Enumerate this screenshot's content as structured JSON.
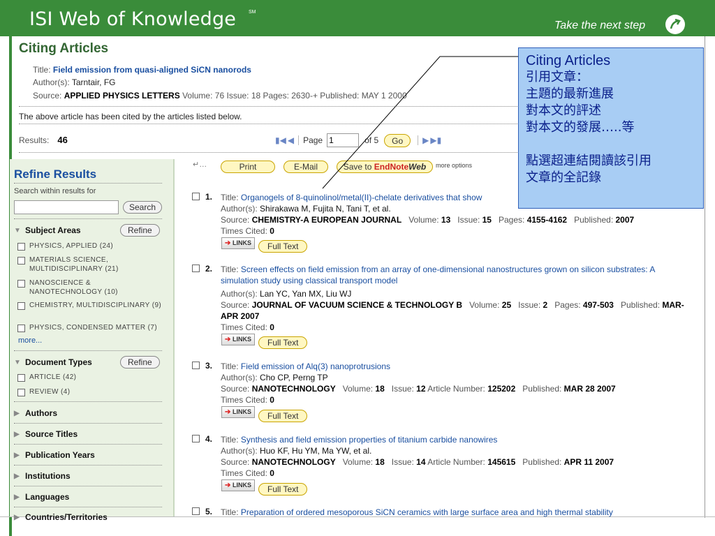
{
  "header": {
    "title": "ISI Web of Knowledge",
    "trademark": "SM",
    "tagline": "Take the next step"
  },
  "page": {
    "title": "Citing Articles",
    "article": {
      "title_label": "Title:",
      "title": "Field emission from quasi-aligned SiCN nanorods",
      "authors_label": "Author(s):",
      "authors": "Tarntair, FG",
      "source_label": "Source:",
      "source": "APPLIED PHYSICS LETTERS",
      "volume_label": "Volume:",
      "volume": "76",
      "issue_label": "Issue:",
      "issue": "18",
      "pages_label": "Pages:",
      "pages": "2630-+",
      "published_label": "Published:",
      "published": "MAY 1 2000"
    },
    "cited_note": "The above article has been cited by the articles listed below.",
    "results_label": "Results:",
    "results_count": "46",
    "pager": {
      "page_label": "Page",
      "page_value": "1",
      "of_label": "of 5",
      "go_label": "Go"
    }
  },
  "toolbar": {
    "print": "Print",
    "email": "E-Mail",
    "save_prefix": "Save to ",
    "save_endnote": "EndNote",
    "save_web": "Web",
    "more_options": "more options"
  },
  "sidebar": {
    "title": "Refine Results",
    "search_hint": "Search within results for",
    "search_button": "Search",
    "subject_areas": {
      "label": "Subject Areas",
      "refine": "Refine",
      "items": [
        "PHYSICS, APPLIED (24)",
        "MATERIALS SCIENCE, MULTIDISCIPLINARY (21)",
        "NANOSCIENCE & NANOTECHNOLOGY (10)",
        "CHEMISTRY, MULTIDISCIPLINARY (9)",
        "PHYSICS, CONDENSED MATTER (7)"
      ],
      "more": "more..."
    },
    "document_types": {
      "label": "Document Types",
      "refine": "Refine",
      "items": [
        "ARTICLE (42)",
        "REVIEW (4)"
      ]
    },
    "collapsed": [
      "Authors",
      "Source Titles",
      "Publication Years",
      "Institutions",
      "Languages",
      "Countries/Territories"
    ]
  },
  "records": [
    {
      "num": "1.",
      "title": "Organogels of 8-quinolinol/metal(II)-chelate derivatives that show",
      "authors": "Shirakawa M, Fujita N, Tani T, et al.",
      "source": "CHEMISTRY-A EUROPEAN JOURNAL",
      "volume": "13",
      "issue": "15",
      "pages": "4155-4162",
      "published": "2007",
      "times_cited": "0"
    },
    {
      "num": "2.",
      "title": "Screen effects on field emission from an array of one-dimensional nanostructures grown on silicon substrates: A simulation study using classical transport model",
      "authors": "Lan YC, Yan MX, Liu WJ",
      "source": "JOURNAL OF VACUUM SCIENCE & TECHNOLOGY B",
      "volume": "25",
      "issue": "2",
      "pages": "497-503",
      "published": "MAR-APR 2007",
      "times_cited": "0"
    },
    {
      "num": "3.",
      "title": "Field emission of Alq(3) nanoprotrusions",
      "authors": "Cho CP, Perng TP",
      "source": "NANOTECHNOLOGY",
      "volume": "18",
      "issue": "12",
      "article_number": "125202",
      "published": "MAR 28 2007",
      "times_cited": "0"
    },
    {
      "num": "4.",
      "title": "Synthesis and field emission properties of titanium carbide nanowires",
      "authors": "Huo KF, Hu YM, Ma YW, et al.",
      "source": "NANOTECHNOLOGY",
      "volume": "18",
      "issue": "14",
      "article_number": "145615",
      "published": "APR 11 2007",
      "times_cited": "0"
    },
    {
      "num": "5.",
      "title": "Preparation of ordered mesoporous SiCN ceramics with large surface area and high thermal stability"
    }
  ],
  "labels": {
    "title": "Title:",
    "authors": "Author(s):",
    "source": "Source:",
    "volume": "Volume:",
    "issue": "Issue:",
    "pages": "Pages:",
    "article_number": "Article Number:",
    "published": "Published:",
    "times_cited": "Times Cited:",
    "links": "LINKS",
    "full_text": "Full Text"
  },
  "callout": {
    "heading": "Citing Articles",
    "lines": [
      "引用文章：",
      "主題的最新進展",
      "對本文的評述",
      "對本文的發展…..等"
    ],
    "footer_lines": [
      "點選超連結閱讀該引用",
      "文章的全記錄"
    ]
  },
  "colors": {
    "header_green": "#3a8c3a",
    "link_blue": "#1a4fa0",
    "callout_fill": "#a8cdf4",
    "callout_text": "#0a1f8a"
  }
}
